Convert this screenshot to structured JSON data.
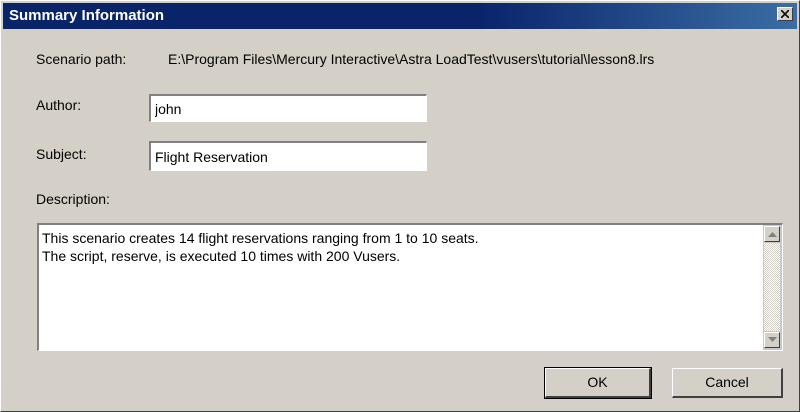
{
  "dialog": {
    "title": "Summary Information",
    "close_icon": "close-icon"
  },
  "scenario": {
    "label": "Scenario path:",
    "value": "E:\\Program Files\\Mercury Interactive\\Astra LoadTest\\vusers\\tutorial\\lesson8.lrs"
  },
  "author": {
    "label": "Author:",
    "value": "john"
  },
  "subject": {
    "label": "Subject:",
    "value": "Flight Reservation"
  },
  "description": {
    "label": "Description:",
    "value": "This scenario creates 14 flight reservations ranging from 1 to 10 seats.\nThe script, reserve, is executed 10 times with 200 Vusers."
  },
  "buttons": {
    "ok": "OK",
    "cancel": "Cancel"
  },
  "colors": {
    "titlebar": "#0a246a",
    "face": "#d4d0c8"
  }
}
